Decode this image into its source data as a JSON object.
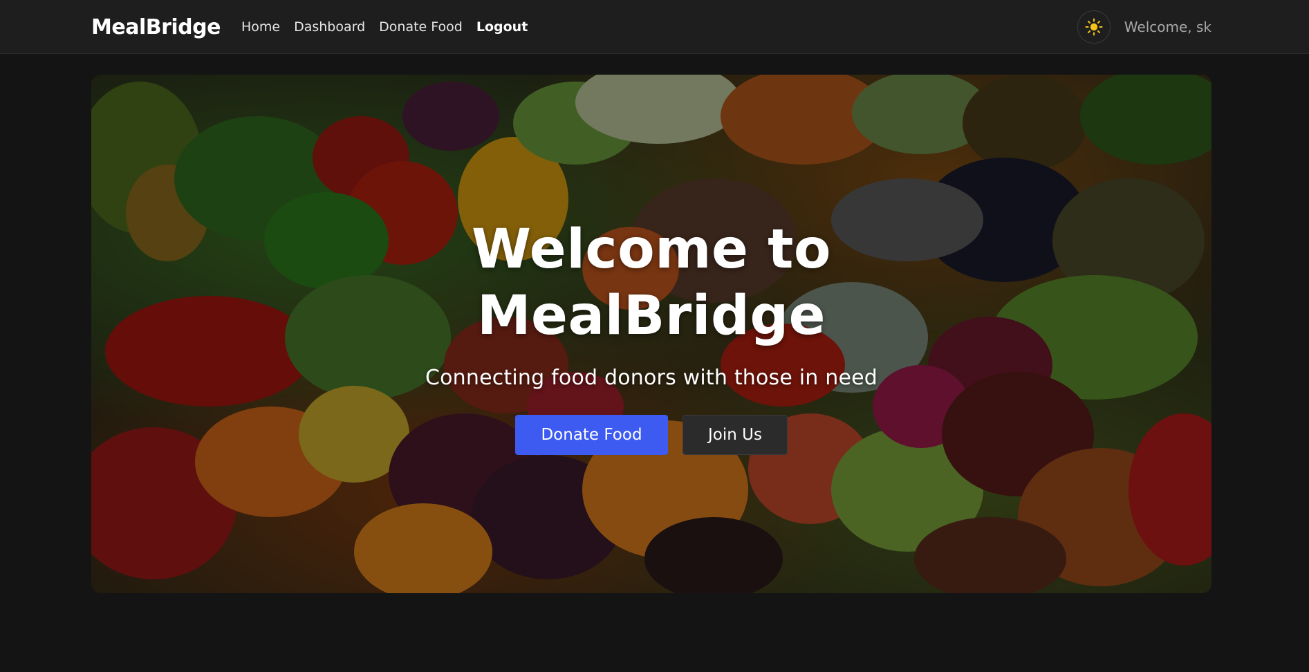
{
  "navbar": {
    "brand": "MealBridge",
    "links": [
      {
        "label": "Home"
      },
      {
        "label": "Dashboard"
      },
      {
        "label": "Donate Food"
      }
    ],
    "logout_label": "Logout",
    "welcome_text": "Welcome, sk",
    "theme_toggle_icon": "sun-icon"
  },
  "hero": {
    "title": "Welcome to MealBridge",
    "subtitle": "Connecting food donors with those in need",
    "primary_button": "Donate Food",
    "secondary_button": "Join Us",
    "background_image": "fresh-produce-market-photo"
  },
  "colors": {
    "page_bg": "#141414",
    "navbar_bg": "#1e1e1e",
    "primary": "#3d5af1",
    "secondary_btn": "#2b2b2b",
    "sun": "#f5c518"
  }
}
